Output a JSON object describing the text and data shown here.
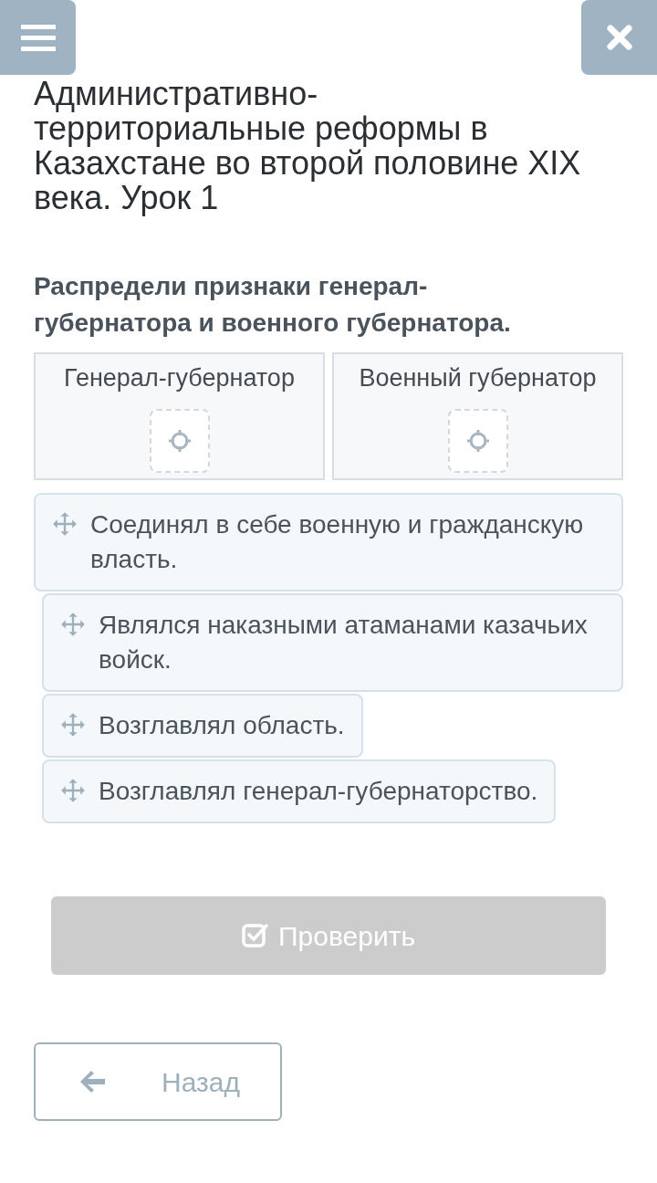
{
  "title": "Административно-территориальные реформы в Казахстане во второй половине XIX века. Урок 1",
  "task": "Распредели признаки генерал-губернатора и военного губернатора.",
  "drop_zones": [
    {
      "label": "Генерал-губернатор"
    },
    {
      "label": "Военный губернатор"
    }
  ],
  "items": [
    {
      "text": "Соединял в себе военную и гражданскую власть."
    },
    {
      "text": "Являлся наказными атаманами казачьих войск."
    },
    {
      "text": "Возглавлял область."
    },
    {
      "text": "Возглавлял генерал-губернаторство."
    }
  ],
  "check_button": {
    "label": "Проверить",
    "disabled": true
  },
  "back_button": {
    "label": "Назад"
  }
}
